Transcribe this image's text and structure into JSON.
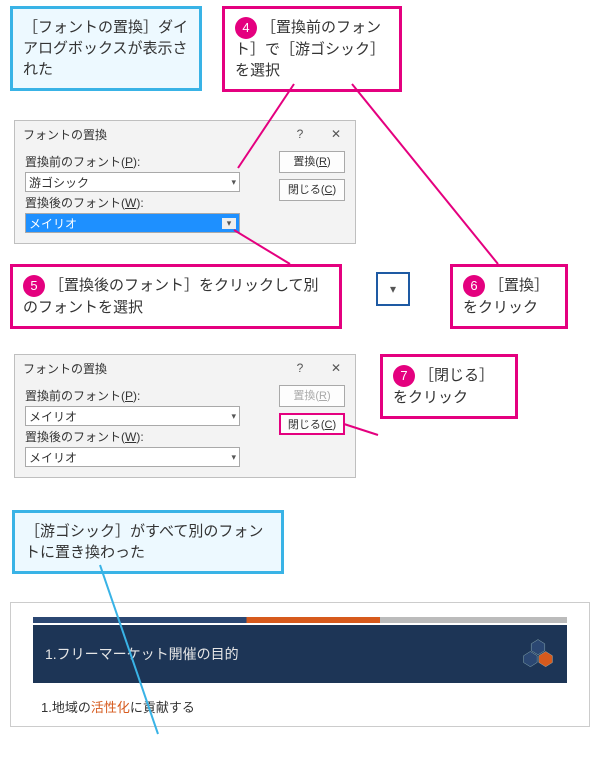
{
  "callouts": {
    "c1": "［フォントの置換］ダイアログボックスが表示された",
    "c4": "［置換前のフォント］で［游ゴシック］を選択",
    "c5": "［置換後のフォント］をクリックして別のフォントを選択",
    "c6": "［置換］をクリック",
    "c7": "［閉じる］をクリック",
    "c8": "［游ゴシック］がすべて別のフォントに置き換わった"
  },
  "steps": {
    "n4": "4",
    "n5": "5",
    "n6": "6",
    "n7": "7"
  },
  "dialog": {
    "title": "フォントの置換",
    "help": "?",
    "close_x": "✕",
    "lbl_before_a": "置換前のフォント(",
    "lbl_before_k": "P",
    "lbl_before_b": "):",
    "lbl_after_a": "置換後のフォント(",
    "lbl_after_k": "W",
    "lbl_after_b": "):",
    "btn_replace_a": "置換(",
    "btn_replace_k": "R",
    "btn_replace_b": ")",
    "btn_close_a": "閉じる(",
    "btn_close_k": "C",
    "btn_close_b": ")"
  },
  "dlg1": {
    "before_val": "游ゴシック",
    "after_val": "メイリオ"
  },
  "dlg2": {
    "before_val": "メイリオ",
    "after_val": "メイリオ"
  },
  "slide": {
    "title": "1.フリーマーケット開催の目的",
    "li_num": "1.",
    "li_a": "地域の",
    "li_h": "活性化",
    "li_b": "に貢献する"
  }
}
